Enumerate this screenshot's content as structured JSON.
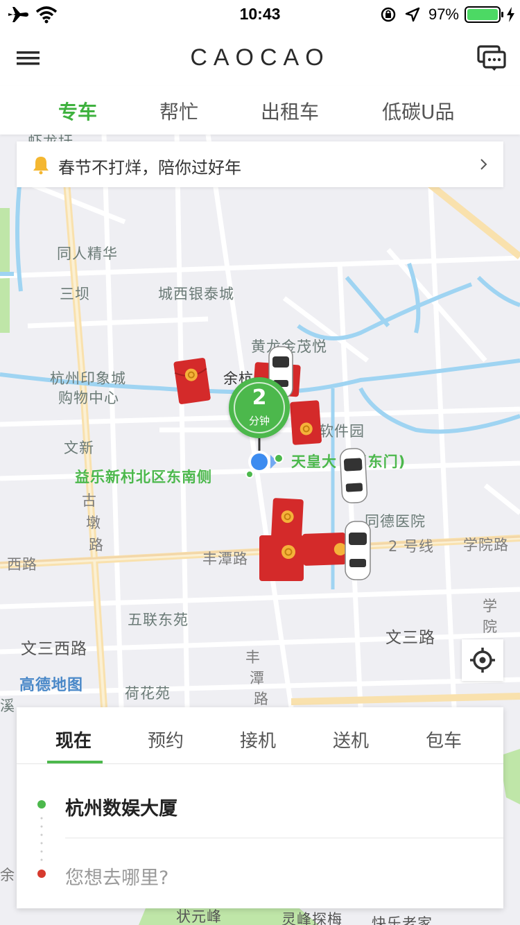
{
  "status_bar": {
    "time": "10:43",
    "battery": "97%"
  },
  "header": {
    "brand": "CAOCAO"
  },
  "service_tabs": [
    {
      "label": "专车",
      "active": true
    },
    {
      "label": "帮忙",
      "active": false
    },
    {
      "label": "出租车",
      "active": false
    },
    {
      "label": "低碳U品",
      "active": false
    }
  ],
  "banner": {
    "text": "春节不打烊，陪你过好年"
  },
  "map": {
    "labels": {
      "hulong": "虾龙圩",
      "tongren": "同人精华",
      "sanba": "三坝",
      "chengxi": "城西银泰城",
      "huanglong": "黄龙金茂悦",
      "yinxiang": "杭州印象城",
      "gouwu": "购物中心",
      "yuhang": "余杭",
      "wenxin": "文新",
      "ruanjian": "软件园",
      "tianhuang": "天皇大",
      "dongmen": "(东门)",
      "yile": "益乐新村北区东南侧",
      "gudun1": "古",
      "gudun2": "墩",
      "gudun3": "路",
      "tongde": "同德医院",
      "xilu": "西路",
      "fengtan": "丰潭路",
      "line2": "2 号线",
      "xueyuan": "学院路",
      "wulian": "五联东苑",
      "xue": "学",
      "yuan": "院",
      "wensan_w": "文三西路",
      "wensan": "文三路",
      "gaode": "高德地图",
      "hehua": "荷花苑",
      "fengtan_v1": "丰",
      "fengtan_v2": "潭",
      "fengtan_v3": "路",
      "zhuangyuan": "状元峰",
      "lingfeng": "灵峰探梅",
      "kuaile": "快乐老家",
      "yu": "余",
      "xi": "溪"
    },
    "eta": {
      "value": "2",
      "unit": "分钟"
    }
  },
  "ride_tabs": [
    {
      "label": "现在",
      "active": true
    },
    {
      "label": "预约",
      "active": false
    },
    {
      "label": "接机",
      "active": false
    },
    {
      "label": "送机",
      "active": false
    },
    {
      "label": "包车",
      "active": false
    }
  ],
  "trip": {
    "pickup": "杭州数娱大厦",
    "destination_placeholder": "您想去哪里?"
  },
  "colors": {
    "accent": "#4cb84c",
    "destination": "#d63a2e",
    "water": "#8fd0f0",
    "road_major": "#f6d896"
  }
}
